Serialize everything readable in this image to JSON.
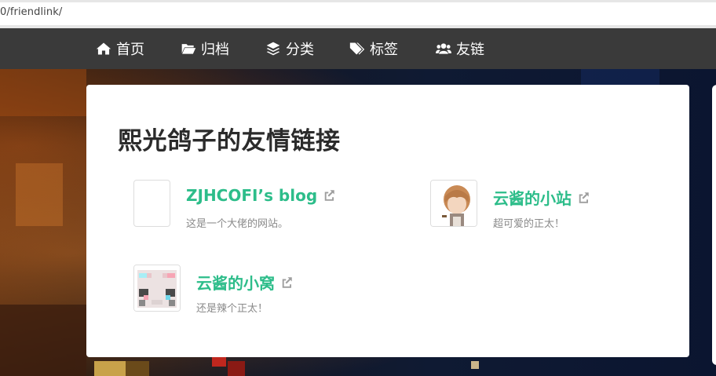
{
  "browser": {
    "url": "0/friendlink/"
  },
  "nav": {
    "items": [
      {
        "label": "首页",
        "icon": "home-icon"
      },
      {
        "label": "归档",
        "icon": "folder-open-icon"
      },
      {
        "label": "分类",
        "icon": "layers-icon"
      },
      {
        "label": "标签",
        "icon": "tags-icon"
      },
      {
        "label": "友链",
        "icon": "users-icon"
      }
    ]
  },
  "page": {
    "title": "熙光鸽子的友情链接"
  },
  "friends": [
    {
      "name": "ZJHCOFI’s blog",
      "desc": "这是一个大佬的网站。",
      "avatar": "blank"
    },
    {
      "name": "云酱的小站",
      "desc": "超可爱的正太！",
      "avatar": "anime-character"
    },
    {
      "name": "云酱的小窝",
      "desc": "还是辣个正太！",
      "avatar": "pixel-character"
    }
  ],
  "colors": {
    "navbar": "#3a3a3a",
    "link_accent": "#2dbd8a",
    "title_text": "#2b2b2b",
    "desc_text": "#8a8a8a"
  }
}
